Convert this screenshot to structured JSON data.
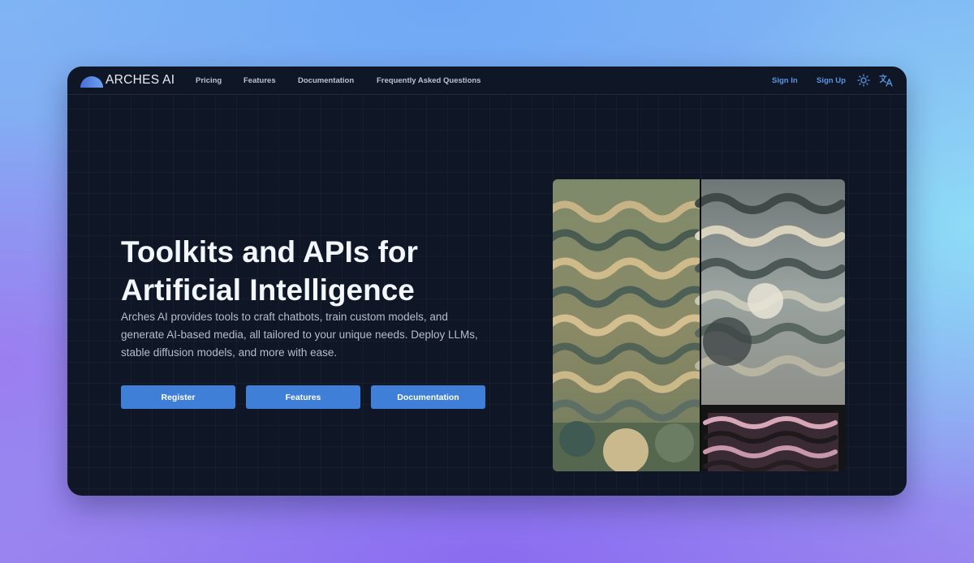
{
  "brand": {
    "name": "ARCHES AI"
  },
  "nav": {
    "links": [
      "Pricing",
      "Features",
      "Documentation",
      "Frequently Asked Questions"
    ],
    "sign_in": "Sign In",
    "sign_up": "Sign Up",
    "icons": [
      "sun-icon",
      "translate-icon"
    ]
  },
  "hero": {
    "title_line1": "Toolkits and APIs for",
    "title_line2": "Artificial Intelligence",
    "description": "Arches AI provides tools to craft chatbots, train custom models, and generate AI-based media, all tailored to your unique needs. Deploy LLMs, stable diffusion models, and more with ease.",
    "buttons": [
      "Register",
      "Features",
      "Documentation"
    ]
  },
  "colors": {
    "accent": "#3f7fd8",
    "link_blue": "#5b95e6",
    "window_bg": "#0f1726"
  }
}
